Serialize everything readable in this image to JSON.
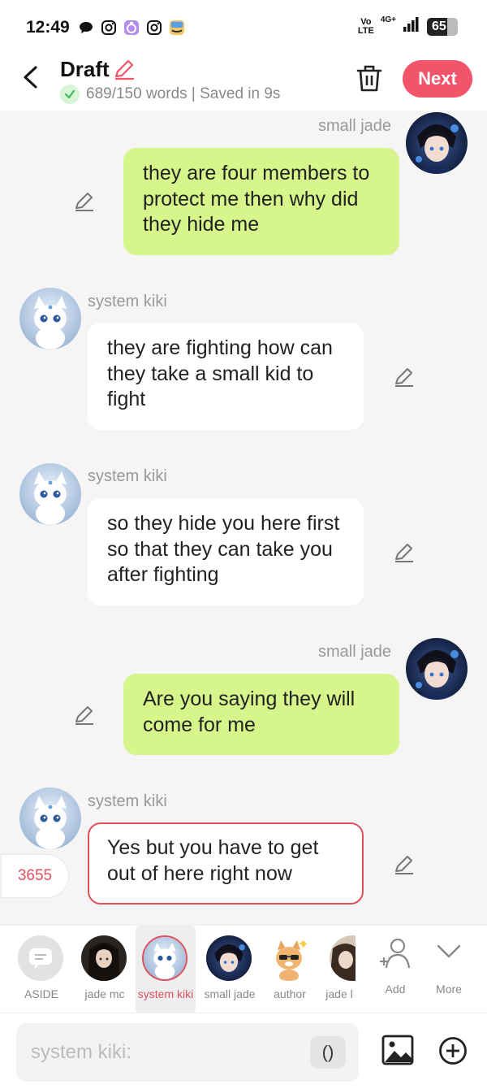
{
  "status_bar": {
    "time": "12:49",
    "volte_top": "Vo",
    "volte_bottom": "LTE",
    "network": "4G+",
    "battery": "65",
    "battery_level": 0.65
  },
  "header": {
    "title": "Draft",
    "subtitle": "689/150 words | Saved in 9s",
    "next_label": "Next"
  },
  "messages": [
    {
      "speaker": "small jade",
      "text": "they are four members to protect me then why did they hide me"
    },
    {
      "speaker": "system kiki",
      "text": "they are fighting how can they take a small kid to fight"
    },
    {
      "speaker": "system kiki",
      "text": "so they hide you here first so that they can take you after fighting"
    },
    {
      "speaker": "small jade",
      "text": "Are you saying they will come for me"
    },
    {
      "speaker": "system kiki",
      "text": "Yes but you have to get out of here right now"
    }
  ],
  "counter": "3655",
  "characters": [
    {
      "label": "ASIDE"
    },
    {
      "label": "jade mc"
    },
    {
      "label": "system kiki"
    },
    {
      "label": "small jade"
    },
    {
      "label": "author"
    },
    {
      "label": "jade l"
    },
    {
      "label": "Add"
    },
    {
      "label": "More"
    }
  ],
  "input": {
    "placeholder": "system kiki:",
    "paren_label": "()"
  },
  "colors": {
    "accent": "#f2546a",
    "right_bubble": "#d6f58a",
    "left_bubble": "#ffffff",
    "selected_border": "#e0505e"
  }
}
